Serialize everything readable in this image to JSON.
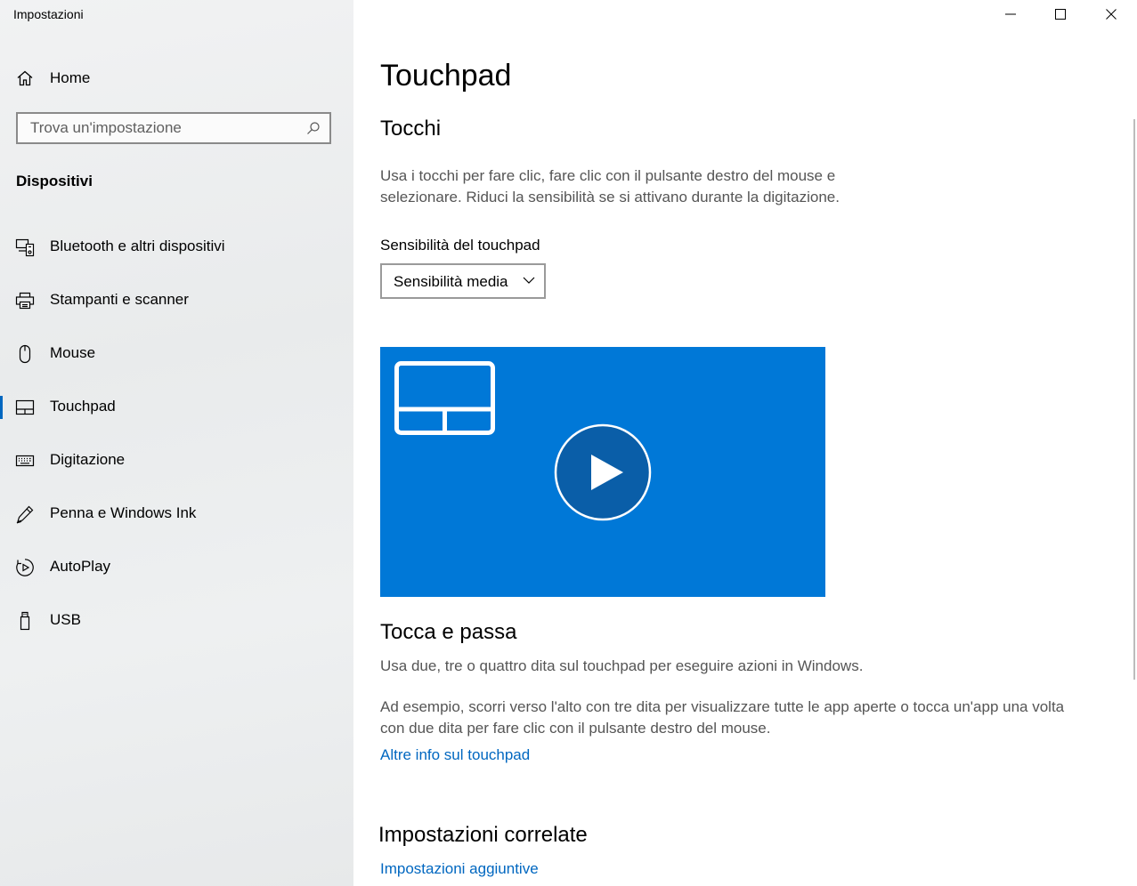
{
  "window": {
    "title": "Impostazioni",
    "controls": [
      "minimize",
      "maximize",
      "close"
    ]
  },
  "sidebar": {
    "home_label": "Home",
    "search_placeholder": "Trova un'impostazione",
    "section_label": "Dispositivi",
    "items": [
      {
        "label": "Bluetooth e altri dispositivi",
        "icon": "bluetooth-devices-icon",
        "selected": false
      },
      {
        "label": "Stampanti e scanner",
        "icon": "printer-icon",
        "selected": false
      },
      {
        "label": "Mouse",
        "icon": "mouse-icon",
        "selected": false
      },
      {
        "label": "Touchpad",
        "icon": "touchpad-icon",
        "selected": true
      },
      {
        "label": "Digitazione",
        "icon": "keyboard-icon",
        "selected": false
      },
      {
        "label": "Penna e Windows Ink",
        "icon": "pen-icon",
        "selected": false
      },
      {
        "label": "AutoPlay",
        "icon": "autoplay-icon",
        "selected": false
      },
      {
        "label": "USB",
        "icon": "usb-icon",
        "selected": false
      }
    ]
  },
  "main": {
    "page_title": "Touchpad",
    "taps": {
      "heading": "Tocchi",
      "description_line1": "Usa i tocchi per fare clic, fare clic con il pulsante destro del mouse e",
      "description_line2": "selezionare. Riduci la sensibilità se si attivano durante la digitazione.",
      "sensitivity_label": "Sensibilità del touchpad",
      "sensitivity_value": "Sensibilità media"
    },
    "video": {
      "icon": "play-icon",
      "background": "#0078d7"
    },
    "swipe": {
      "heading": "Tocca e passa",
      "description": "Usa due, tre o quattro dita sul touchpad per eseguire azioni in Windows.",
      "example_line1": "Ad esempio, scorri verso l'alto con tre dita per visualizzare tutte le app aperte o tocca un'app una volta",
      "example_line2": "con due dita per fare clic con il pulsante destro del mouse.",
      "link": "Altre info sul touchpad"
    },
    "related": {
      "heading": "Impostazioni correlate",
      "link": "Impostazioni aggiuntive"
    }
  },
  "colors": {
    "accent": "#0067c0",
    "video_bg": "#0078d7",
    "play_circle": "#0a5ea8"
  }
}
